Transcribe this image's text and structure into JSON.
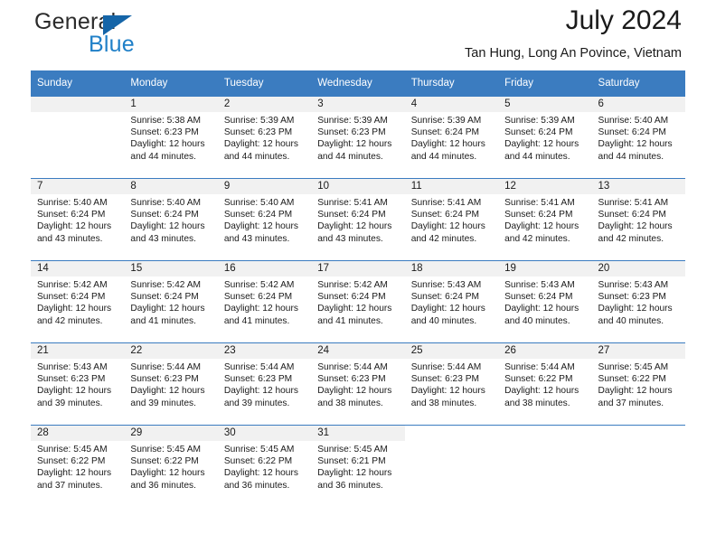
{
  "branding": {
    "name_primary": "General",
    "name_secondary": "Blue",
    "triangle_icon": "blue-triangle-icon"
  },
  "header": {
    "title": "July 2024",
    "subtitle": "Tan Hung, Long An Povince, Vietnam"
  },
  "colors": {
    "header_blue": "#3b7cc0",
    "logo_blue": "#2080c8",
    "daynum_band": "#f1f1f1",
    "text": "#1a1a1a"
  },
  "weekday_headers": [
    "Sunday",
    "Monday",
    "Tuesday",
    "Wednesday",
    "Thursday",
    "Friday",
    "Saturday"
  ],
  "labels": {
    "sunrise_prefix": "Sunrise: ",
    "sunset_prefix": "Sunset: ",
    "daylight_prefix": "Daylight: "
  },
  "weeks": [
    [
      {
        "day": "",
        "sunrise": "",
        "sunset": "",
        "daylight": "",
        "empty": true
      },
      {
        "day": "1",
        "sunrise": "Sunrise: 5:38 AM",
        "sunset": "Sunset: 6:23 PM",
        "daylight": "Daylight: 12 hours and 44 minutes."
      },
      {
        "day": "2",
        "sunrise": "Sunrise: 5:39 AM",
        "sunset": "Sunset: 6:23 PM",
        "daylight": "Daylight: 12 hours and 44 minutes."
      },
      {
        "day": "3",
        "sunrise": "Sunrise: 5:39 AM",
        "sunset": "Sunset: 6:23 PM",
        "daylight": "Daylight: 12 hours and 44 minutes."
      },
      {
        "day": "4",
        "sunrise": "Sunrise: 5:39 AM",
        "sunset": "Sunset: 6:24 PM",
        "daylight": "Daylight: 12 hours and 44 minutes."
      },
      {
        "day": "5",
        "sunrise": "Sunrise: 5:39 AM",
        "sunset": "Sunset: 6:24 PM",
        "daylight": "Daylight: 12 hours and 44 minutes."
      },
      {
        "day": "6",
        "sunrise": "Sunrise: 5:40 AM",
        "sunset": "Sunset: 6:24 PM",
        "daylight": "Daylight: 12 hours and 44 minutes."
      }
    ],
    [
      {
        "day": "7",
        "sunrise": "Sunrise: 5:40 AM",
        "sunset": "Sunset: 6:24 PM",
        "daylight": "Daylight: 12 hours and 43 minutes."
      },
      {
        "day": "8",
        "sunrise": "Sunrise: 5:40 AM",
        "sunset": "Sunset: 6:24 PM",
        "daylight": "Daylight: 12 hours and 43 minutes."
      },
      {
        "day": "9",
        "sunrise": "Sunrise: 5:40 AM",
        "sunset": "Sunset: 6:24 PM",
        "daylight": "Daylight: 12 hours and 43 minutes."
      },
      {
        "day": "10",
        "sunrise": "Sunrise: 5:41 AM",
        "sunset": "Sunset: 6:24 PM",
        "daylight": "Daylight: 12 hours and 43 minutes."
      },
      {
        "day": "11",
        "sunrise": "Sunrise: 5:41 AM",
        "sunset": "Sunset: 6:24 PM",
        "daylight": "Daylight: 12 hours and 42 minutes."
      },
      {
        "day": "12",
        "sunrise": "Sunrise: 5:41 AM",
        "sunset": "Sunset: 6:24 PM",
        "daylight": "Daylight: 12 hours and 42 minutes."
      },
      {
        "day": "13",
        "sunrise": "Sunrise: 5:41 AM",
        "sunset": "Sunset: 6:24 PM",
        "daylight": "Daylight: 12 hours and 42 minutes."
      }
    ],
    [
      {
        "day": "14",
        "sunrise": "Sunrise: 5:42 AM",
        "sunset": "Sunset: 6:24 PM",
        "daylight": "Daylight: 12 hours and 42 minutes."
      },
      {
        "day": "15",
        "sunrise": "Sunrise: 5:42 AM",
        "sunset": "Sunset: 6:24 PM",
        "daylight": "Daylight: 12 hours and 41 minutes."
      },
      {
        "day": "16",
        "sunrise": "Sunrise: 5:42 AM",
        "sunset": "Sunset: 6:24 PM",
        "daylight": "Daylight: 12 hours and 41 minutes."
      },
      {
        "day": "17",
        "sunrise": "Sunrise: 5:42 AM",
        "sunset": "Sunset: 6:24 PM",
        "daylight": "Daylight: 12 hours and 41 minutes."
      },
      {
        "day": "18",
        "sunrise": "Sunrise: 5:43 AM",
        "sunset": "Sunset: 6:24 PM",
        "daylight": "Daylight: 12 hours and 40 minutes."
      },
      {
        "day": "19",
        "sunrise": "Sunrise: 5:43 AM",
        "sunset": "Sunset: 6:24 PM",
        "daylight": "Daylight: 12 hours and 40 minutes."
      },
      {
        "day": "20",
        "sunrise": "Sunrise: 5:43 AM",
        "sunset": "Sunset: 6:23 PM",
        "daylight": "Daylight: 12 hours and 40 minutes."
      }
    ],
    [
      {
        "day": "21",
        "sunrise": "Sunrise: 5:43 AM",
        "sunset": "Sunset: 6:23 PM",
        "daylight": "Daylight: 12 hours and 39 minutes."
      },
      {
        "day": "22",
        "sunrise": "Sunrise: 5:44 AM",
        "sunset": "Sunset: 6:23 PM",
        "daylight": "Daylight: 12 hours and 39 minutes."
      },
      {
        "day": "23",
        "sunrise": "Sunrise: 5:44 AM",
        "sunset": "Sunset: 6:23 PM",
        "daylight": "Daylight: 12 hours and 39 minutes."
      },
      {
        "day": "24",
        "sunrise": "Sunrise: 5:44 AM",
        "sunset": "Sunset: 6:23 PM",
        "daylight": "Daylight: 12 hours and 38 minutes."
      },
      {
        "day": "25",
        "sunrise": "Sunrise: 5:44 AM",
        "sunset": "Sunset: 6:23 PM",
        "daylight": "Daylight: 12 hours and 38 minutes."
      },
      {
        "day": "26",
        "sunrise": "Sunrise: 5:44 AM",
        "sunset": "Sunset: 6:22 PM",
        "daylight": "Daylight: 12 hours and 38 minutes."
      },
      {
        "day": "27",
        "sunrise": "Sunrise: 5:45 AM",
        "sunset": "Sunset: 6:22 PM",
        "daylight": "Daylight: 12 hours and 37 minutes."
      }
    ],
    [
      {
        "day": "28",
        "sunrise": "Sunrise: 5:45 AM",
        "sunset": "Sunset: 6:22 PM",
        "daylight": "Daylight: 12 hours and 37 minutes."
      },
      {
        "day": "29",
        "sunrise": "Sunrise: 5:45 AM",
        "sunset": "Sunset: 6:22 PM",
        "daylight": "Daylight: 12 hours and 36 minutes."
      },
      {
        "day": "30",
        "sunrise": "Sunrise: 5:45 AM",
        "sunset": "Sunset: 6:22 PM",
        "daylight": "Daylight: 12 hours and 36 minutes."
      },
      {
        "day": "31",
        "sunrise": "Sunrise: 5:45 AM",
        "sunset": "Sunset: 6:21 PM",
        "daylight": "Daylight: 12 hours and 36 minutes."
      },
      {
        "day": "",
        "sunrise": "",
        "sunset": "",
        "daylight": "",
        "empty": true,
        "nofill": true
      },
      {
        "day": "",
        "sunrise": "",
        "sunset": "",
        "daylight": "",
        "empty": true,
        "nofill": true
      },
      {
        "day": "",
        "sunrise": "",
        "sunset": "",
        "daylight": "",
        "empty": true,
        "nofill": true
      }
    ]
  ]
}
